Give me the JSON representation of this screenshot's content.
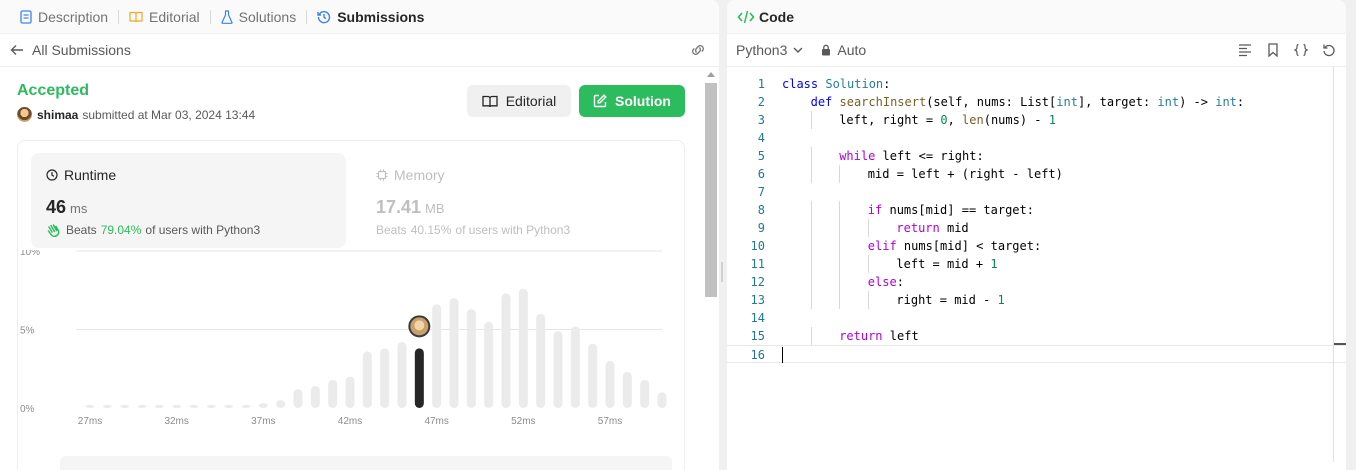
{
  "tabs": [
    {
      "label": "Description",
      "icon": "description-icon"
    },
    {
      "label": "Editorial",
      "icon": "book-icon"
    },
    {
      "label": "Solutions",
      "icon": "flask-icon"
    },
    {
      "label": "Submissions",
      "icon": "history-icon",
      "active": true
    }
  ],
  "subbar": {
    "back_label": "All Submissions"
  },
  "submission": {
    "status": "Accepted",
    "user": "shimaa",
    "submitted_text": "submitted at Mar 03, 2024 13:44",
    "editorial_button": "Editorial",
    "solution_button": "Solution"
  },
  "runtime": {
    "title": "Runtime",
    "value": "46",
    "unit": "ms",
    "beats_prefix": "Beats",
    "beats_pct": "79.04%",
    "beats_suffix": "of users with Python3"
  },
  "memory": {
    "title": "Memory",
    "value": "17.41",
    "unit": "MB",
    "beats_prefix": "Beats",
    "beats_pct": "40.15%",
    "beats_suffix": "of users with Python3"
  },
  "chart_data": {
    "type": "bar",
    "title": "",
    "xlabel": "",
    "ylabel": "",
    "ylim": [
      0,
      10
    ],
    "yticks": [
      "0%",
      "5%",
      "10%"
    ],
    "xticks": [
      "27ms",
      "32ms",
      "37ms",
      "42ms",
      "47ms",
      "52ms",
      "57ms"
    ],
    "categories": [
      27,
      28,
      29,
      30,
      31,
      32,
      33,
      34,
      35,
      36,
      37,
      38,
      39,
      40,
      41,
      42,
      43,
      44,
      45,
      46,
      47,
      48,
      49,
      50,
      51,
      52,
      53,
      54,
      55,
      56,
      57,
      58,
      59,
      60
    ],
    "values": [
      0.2,
      0.2,
      0.2,
      0.2,
      0.2,
      0.2,
      0.2,
      0.2,
      0.2,
      0.2,
      0.3,
      0.5,
      1.2,
      1.4,
      1.8,
      2.0,
      3.6,
      3.8,
      4.2,
      3.8,
      6.6,
      7.0,
      6.3,
      5.5,
      7.3,
      7.6,
      6.0,
      4.9,
      5.2,
      4.1,
      3.0,
      2.3,
      1.8,
      1.0
    ],
    "highlight_category": 46,
    "colors": {
      "bar": "#ebebeb",
      "highlight": "#262626",
      "grid": "#e6e6e6"
    },
    "grid": true
  },
  "code_panel": {
    "title": "Code",
    "language": "Python3",
    "mode": "Auto",
    "tools": [
      "format-icon",
      "bookmark-icon",
      "braces-icon",
      "reset-icon"
    ]
  },
  "code_lines": [
    {
      "n": "1",
      "indent": 0,
      "tokens": [
        [
          "kb",
          "class "
        ],
        [
          "cls",
          "Solution"
        ],
        [
          "",
          ":"
        ]
      ]
    },
    {
      "n": "2",
      "indent": 1,
      "tokens": [
        [
          "kb",
          "def "
        ],
        [
          "fn",
          "searchInsert"
        ],
        [
          "",
          "(self, nums: List["
        ],
        [
          "cls",
          "int"
        ],
        [
          "",
          "], target: "
        ],
        [
          "cls",
          "int"
        ],
        [
          "",
          ") -> "
        ],
        [
          "cls",
          "int"
        ],
        [
          "",
          ":"
        ]
      ]
    },
    {
      "n": "3",
      "indent": 2,
      "tokens": [
        [
          "",
          "left, right = "
        ],
        [
          "num",
          "0"
        ],
        [
          "",
          ", "
        ],
        [
          "fn",
          "len"
        ],
        [
          "",
          "(nums) - "
        ],
        [
          "num",
          "1"
        ]
      ]
    },
    {
      "n": "4",
      "indent": 0,
      "tokens": []
    },
    {
      "n": "5",
      "indent": 2,
      "tokens": [
        [
          "kw",
          "while "
        ],
        [
          "",
          "left <= right:"
        ]
      ]
    },
    {
      "n": "6",
      "indent": 3,
      "tokens": [
        [
          "",
          "mid = left + (right - left)"
        ]
      ]
    },
    {
      "n": "7",
      "indent": 0,
      "tokens": []
    },
    {
      "n": "8",
      "indent": 3,
      "tokens": [
        [
          "kw",
          "if "
        ],
        [
          "",
          "nums[mid] == target:"
        ]
      ]
    },
    {
      "n": "9",
      "indent": 4,
      "tokens": [
        [
          "kw",
          "return "
        ],
        [
          "",
          "mid"
        ]
      ]
    },
    {
      "n": "10",
      "indent": 3,
      "tokens": [
        [
          "kw",
          "elif "
        ],
        [
          "",
          "nums[mid] < target:"
        ]
      ]
    },
    {
      "n": "11",
      "indent": 4,
      "tokens": [
        [
          "",
          "left = mid + "
        ],
        [
          "num",
          "1"
        ]
      ]
    },
    {
      "n": "12",
      "indent": 3,
      "tokens": [
        [
          "kw",
          "else"
        ],
        [
          "",
          ":"
        ]
      ]
    },
    {
      "n": "13",
      "indent": 4,
      "tokens": [
        [
          "",
          "right = mid - "
        ],
        [
          "num",
          "1"
        ]
      ]
    },
    {
      "n": "14",
      "indent": 0,
      "tokens": []
    },
    {
      "n": "15",
      "indent": 2,
      "tokens": [
        [
          "kw",
          "return "
        ],
        [
          "",
          "left"
        ]
      ]
    },
    {
      "n": "16",
      "indent": 0,
      "tokens": [],
      "current": true
    }
  ]
}
